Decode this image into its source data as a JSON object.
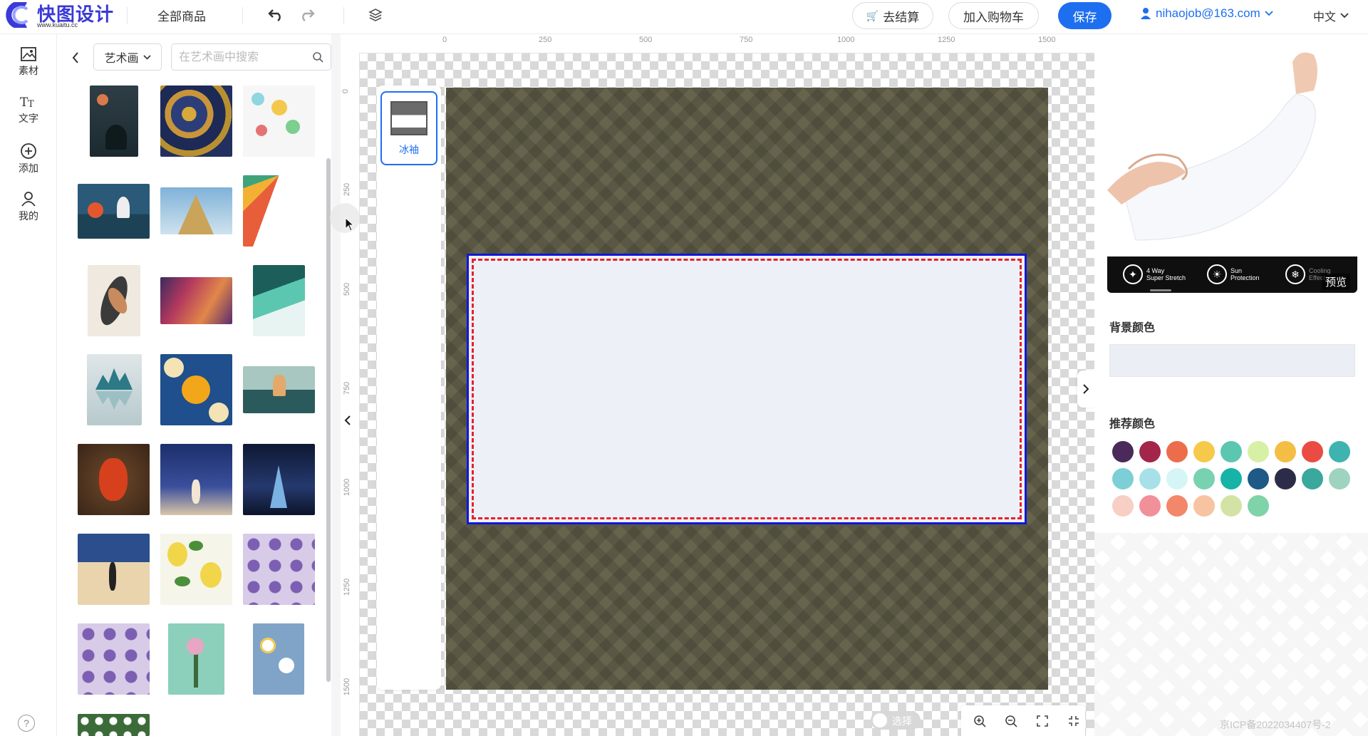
{
  "brand": {
    "name": "快图设计",
    "url": "www.kuaitu.cc"
  },
  "header": {
    "all_goods": "全部商品",
    "checkout": "去结算",
    "add_cart": "加入购物车",
    "save": "保存",
    "user_email": "nihaojob@163.com",
    "language": "中文"
  },
  "leftnav": {
    "items": [
      {
        "label": "素材",
        "icon": "image-icon"
      },
      {
        "label": "文字",
        "icon": "text-icon"
      },
      {
        "label": "添加",
        "icon": "plus-circle-icon"
      },
      {
        "label": "我的",
        "icon": "user-icon"
      }
    ]
  },
  "panel": {
    "category": "艺术画",
    "search_placeholder": "在艺术画中搜索"
  },
  "rulers": {
    "h": [
      "0",
      "250",
      "500",
      "750",
      "1000",
      "1250",
      "1500"
    ],
    "v": [
      "0",
      "250",
      "500",
      "750",
      "1000",
      "1250",
      "1500"
    ]
  },
  "template": {
    "label": "冰袖"
  },
  "canvas": {
    "toggle_label": "选择"
  },
  "right": {
    "preview_tag": "预览",
    "features": [
      {
        "line1": "4 Way",
        "line2": "Super Stretch"
      },
      {
        "line1": "Sun",
        "line2": "Protection"
      },
      {
        "line1": "Cooling",
        "line2": "Effect"
      }
    ],
    "bg_color_title": "背景颜色",
    "bg_color_value": "#eceef5",
    "recommend_title": "推荐颜色",
    "colors": [
      "#4a2a5a",
      "#a3264a",
      "#ec6d4c",
      "#f6c94a",
      "#5cc7b0",
      "#d6f0a6",
      "#f4bd44",
      "#ea4c44",
      "#3fb3b0",
      "#7ccfd6",
      "#a8e0ea",
      "#d6f5f6",
      "#78d2b2",
      "#16b3a6",
      "#1f5a86",
      "#2d2c48",
      "#3aa89c",
      "#9ed4bf",
      "#f8cfc4",
      "#f2909a",
      "#f3876a",
      "#f7c3a1",
      "#d3e3a6",
      "#7fd3a8"
    ]
  },
  "footer": {
    "icp": "京ICP备2022034407号-2"
  }
}
